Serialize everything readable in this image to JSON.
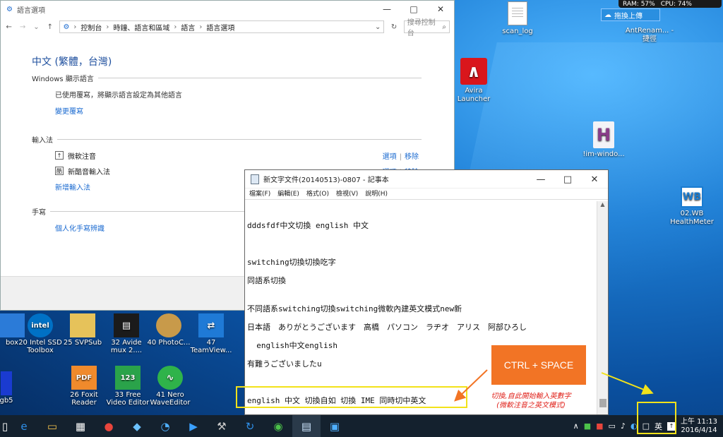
{
  "system_monitor": {
    "ram": "RAM: 57%",
    "cpu": "CPU: 74%"
  },
  "upload_button": "拖換上傳",
  "desktop_icons": [
    {
      "label": "scan_log",
      "icon": "document-icon"
    },
    {
      "label": "AntRenam... - 捷徑",
      "icon": "app-icon"
    },
    {
      "label": "Avira Launcher",
      "icon": "avira-icon"
    },
    {
      "label": "!im-windo...",
      "icon": "h-app-icon"
    },
    {
      "label": "02.WB HealthMeter",
      "icon": "wb-icon"
    }
  ],
  "lower_icons": [
    {
      "label": "box",
      "color": "#2b7bd8"
    },
    {
      "label": "20 Intel SSD Toolbox",
      "color": "#0071c5"
    },
    {
      "label": "25 SVPSub",
      "color": "#e6c25a"
    },
    {
      "label": "32 Avide mux 2....",
      "color": "#1b1b1b"
    },
    {
      "label": "40 PhotoC...",
      "color": "#c89a4a"
    },
    {
      "label": "47 TeamView...",
      "color": "#1f7ad6"
    },
    {
      "label": "gb5",
      "color": "#1a3bd0"
    },
    {
      "label": "26 Foxit Reader",
      "color": "#f08a2c"
    },
    {
      "label": "33 Free Video Editor",
      "color": "#2aa34a"
    },
    {
      "label": "41 Nero WaveEditor",
      "color": "#2fb34a"
    }
  ],
  "control_panel": {
    "title": "語言選項",
    "breadcrumb": [
      "控制台",
      "時鐘、語言和區域",
      "語言",
      "語言選項"
    ],
    "search_placeholder": "搜尋控制台",
    "language_heading": "中文 (繁體，台灣)",
    "windows_display_language": "Windows 顯示語言",
    "override_text": "已使用覆寫，將顯示語言設定為其他語言",
    "change_override_link": "變更覆寫",
    "input_method_heading": "輸入法",
    "input_methods": [
      {
        "name": "微軟注音",
        "options": "選項",
        "remove": "移除"
      },
      {
        "name": "新酷音輸入法",
        "options": "選項",
        "remove": "移除"
      }
    ],
    "add_input_method_link": "新增輸入法",
    "handwriting_heading": "手寫",
    "personalize_link": "個人化手寫辨識"
  },
  "notepad": {
    "title": "新文字文件(20140513)-0807 - 記事本",
    "menu": [
      "檔案(F)",
      "編輯(E)",
      "格式(O)",
      "檢視(V)",
      "說明(H)"
    ],
    "lines": [
      "dddsfdf中文切換 english 中文",
      "switching切換切換吃字",
      "同語系切換",
      "不同語系switching切換switching微軟內建英文模式new新",
      "日本語　ありがとうございます　高橋　パソコン　ラヂオ　アリス　阿部ひろし",
      "  english中文english",
      "有難うございましたu",
      "english 中文 切換自如 切換 IME 同時切中英文"
    ]
  },
  "callout": {
    "label": "CTRL + SPACE",
    "annotation_line1": "切換,自此開始輸入英數字",
    "annotation_line2": "(微軟注音之英文模式)"
  },
  "taskbar": {
    "ime_indicator": "英",
    "time": "上午 11:13",
    "date": "2016/4/14"
  }
}
